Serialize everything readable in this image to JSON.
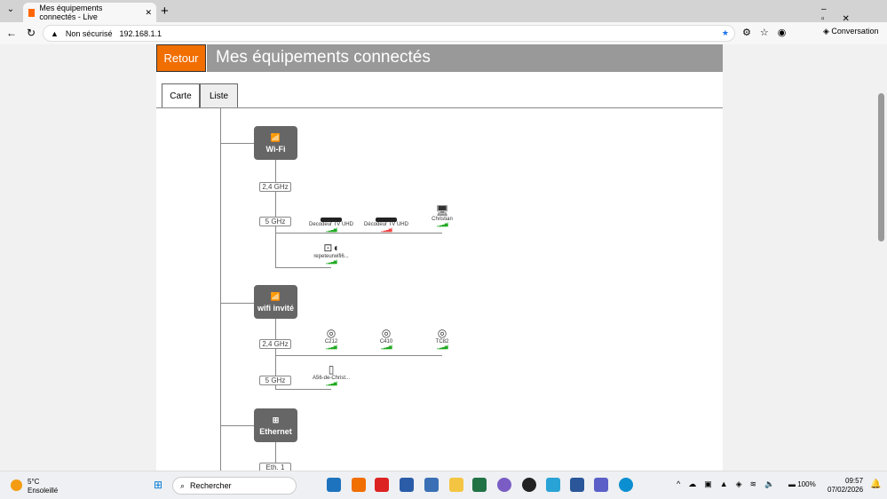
{
  "browser": {
    "tab_title": "Mes équipements connectés - Live",
    "security": "Non sécurisé",
    "url": "192.168.1.1",
    "conversation": "Conversation"
  },
  "header": {
    "back": "Retour",
    "title": "Mes équipements connectés"
  },
  "tabs": [
    {
      "label": "Carte"
    },
    {
      "label": "Liste"
    }
  ],
  "wifi": {
    "label": "Wi-Fi",
    "bands": [
      "2,4 GHz",
      "5 GHz"
    ],
    "devices_5": [
      {
        "name": "Decodeur TV UHD",
        "signal": "good"
      },
      {
        "name": "Décodeur TV UHD",
        "signal": "weak"
      },
      {
        "name": "Christian",
        "signal": "good"
      }
    ],
    "devices_5b": [
      {
        "name": "repeteurwifi6...",
        "signal": "good"
      }
    ]
  },
  "guest": {
    "label": "wifi invité",
    "bands": [
      "2,4 GHz",
      "5 GHz"
    ],
    "devices_24": [
      {
        "name": "C212"
      },
      {
        "name": "C410"
      },
      {
        "name": "TC82"
      }
    ],
    "devices_5": [
      {
        "name": "A56-de-Christ..."
      }
    ]
  },
  "ethernet": {
    "label": "Ethernet",
    "ports": [
      "Eth. 1"
    ]
  },
  "taskbar": {
    "weather_temp": "5°C",
    "weather_desc": "Ensoleillé",
    "search": "Rechercher",
    "battery": "100%",
    "time": "09:57",
    "date": "07/02/2026"
  },
  "colors": {
    "accent": "#f16e00",
    "hub": "#666666",
    "signal_good": "#22aa22",
    "signal_weak": "#ee4444"
  }
}
